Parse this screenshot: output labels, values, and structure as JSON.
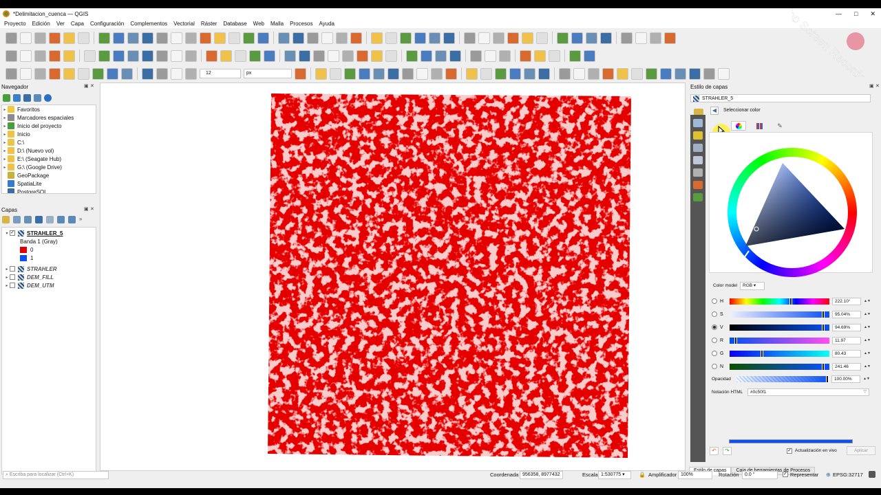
{
  "window": {
    "title": "*Delimitacion_cuenca — QGIS",
    "min": "—",
    "max": "□",
    "close": "✕"
  },
  "menu": [
    "Proyecto",
    "Edición",
    "Ver",
    "Capa",
    "Configuración",
    "Complementos",
    "Vectorial",
    "Ráster",
    "Database",
    "Web",
    "Malla",
    "Procesos",
    "Ayuda"
  ],
  "toolbar": {
    "snap_value": "12",
    "snap_unit": "px"
  },
  "navigator": {
    "title": "Navegador",
    "items": [
      {
        "label": "Favoritos",
        "icon": "star-icon",
        "color": "#f2c744"
      },
      {
        "label": "Marcadores espaciales",
        "icon": "bookmark-icon",
        "color": "#8c8c8c"
      },
      {
        "label": "Inicio del proyecto",
        "icon": "project-home-icon",
        "color": "#4c9b3f"
      },
      {
        "label": "Inicio",
        "icon": "folder-icon",
        "color": "#f0c24a"
      },
      {
        "label": "C:\\",
        "icon": "drive-icon",
        "color": "#f0c24a"
      },
      {
        "label": "D:\\ (Nuevo vol)",
        "icon": "drive-icon",
        "color": "#f0c24a"
      },
      {
        "label": "E:\\ (Seagate Hub)",
        "icon": "drive-icon",
        "color": "#f0c24a"
      },
      {
        "label": "G:\\ (Google Drive)",
        "icon": "drive-icon",
        "color": "#f0c24a"
      },
      {
        "label": "GeoPackage",
        "icon": "geopackage-icon",
        "color": "#c8b23a"
      },
      {
        "label": "SpatiaLite",
        "icon": "spatialite-icon",
        "color": "#3a7bc8"
      },
      {
        "label": "PostgreSQL",
        "icon": "postgresql-icon",
        "color": "#3a6ea5"
      }
    ]
  },
  "layers": {
    "title": "Capas",
    "items": [
      {
        "label": "STRAHLER_5",
        "checked": "✓",
        "bold": true,
        "underline": true
      },
      {
        "label": "STRAHLER",
        "checked": "",
        "italic": true
      },
      {
        "label": "DEM_FILL",
        "checked": "",
        "italic": true
      },
      {
        "label": "DEM_UTM",
        "checked": "",
        "italic": true
      }
    ],
    "band": "Banda 1 (Gray)",
    "classes": [
      {
        "label": "0",
        "color": "#e50000"
      },
      {
        "label": "1",
        "color": "#0c50f1"
      }
    ]
  },
  "style_panel": {
    "title": "Estilo de capas",
    "layer": "STRAHLER_5",
    "back_label": "Seleccionar color",
    "color_model_label": "Color model",
    "color_model": "RGB",
    "channels": [
      {
        "key": "H",
        "value": "222.10°",
        "pos": 0.62,
        "checked": false
      },
      {
        "key": "S",
        "value": "95.04%",
        "pos": 0.95,
        "checked": false
      },
      {
        "key": "V",
        "value": "94.69%",
        "pos": 0.95,
        "checked": true
      },
      {
        "key": "R",
        "value": "11.97",
        "pos": 0.05,
        "checked": false
      },
      {
        "key": "G",
        "value": "80.43",
        "pos": 0.32,
        "checked": false
      },
      {
        "key": "N",
        "value": "241.46",
        "pos": 0.95,
        "checked": false
      }
    ],
    "opacity_label": "Opacidad",
    "opacity_value": "100.00%",
    "html_label": "Notación HTML",
    "html_value": "#0c50f1",
    "live_update_label": "Actualización en vivo",
    "apply_label": "Aplicar",
    "tabs": [
      "Estilo de capas",
      "Caja de herramientas de Procesos"
    ]
  },
  "status": {
    "search_placeholder": "Escriba para localizar (Ctrl+K)",
    "coord_label": "Coordenada",
    "coord_value": "956358, 8977432",
    "scale_label": "Escala",
    "scale_value": "1:530775",
    "magnifier_label": "Amplificador",
    "magnifier_value": "100%",
    "rotation_label": "Rotación",
    "rotation_value": "0.0 °",
    "render_label": "Representar",
    "crs": "EPSG:32717"
  },
  "watermark": "iTop Screen Recorder",
  "colors": {
    "raster_red": "#e50000",
    "selected_blue": "#0c50f1"
  }
}
